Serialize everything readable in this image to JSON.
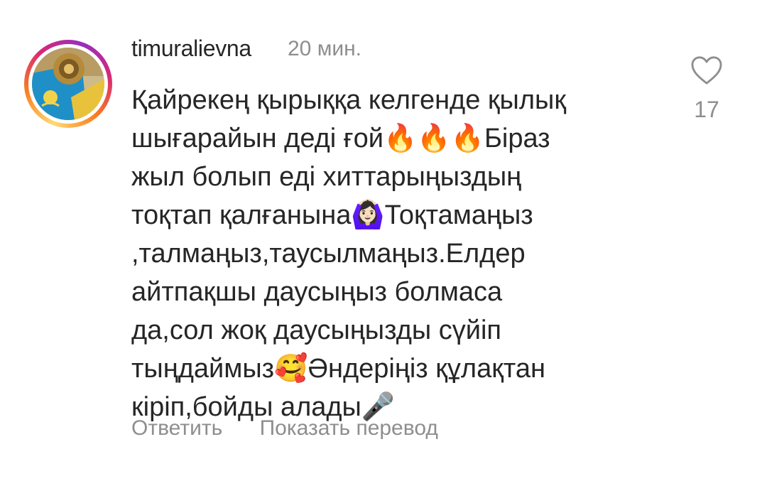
{
  "comment": {
    "username": "timuralievna",
    "time": "20 мин.",
    "lines": [
      "Қайрекең қырыққа келгенде қылық",
      "шығарайын деді ғой🔥🔥🔥Біраз",
      "жыл болып еді хиттарыңыздың",
      "тоқтап қалғанына🙆🏻‍♀️Тоқтамаңыз",
      ",талмаңыз,таусылмаңыз.Елдер",
      "айтпақшы даусыңыз болмаса",
      "да,сол жоқ даусыңызды сүйіп",
      "тыңдаймыз🥰Әндеріңіз құлақтан",
      "кіріп,бойды алады🎤"
    ],
    "likes": "17",
    "reply_label": "Ответить",
    "translate_label": "Показать перевод"
  },
  "icons": {
    "like": "heart-outline-icon",
    "avatar": "kazakhstan-flag-emblem-avatar"
  },
  "colors": {
    "text": "#262626",
    "secondary": "#8e8e8e",
    "background": "#ffffff"
  }
}
